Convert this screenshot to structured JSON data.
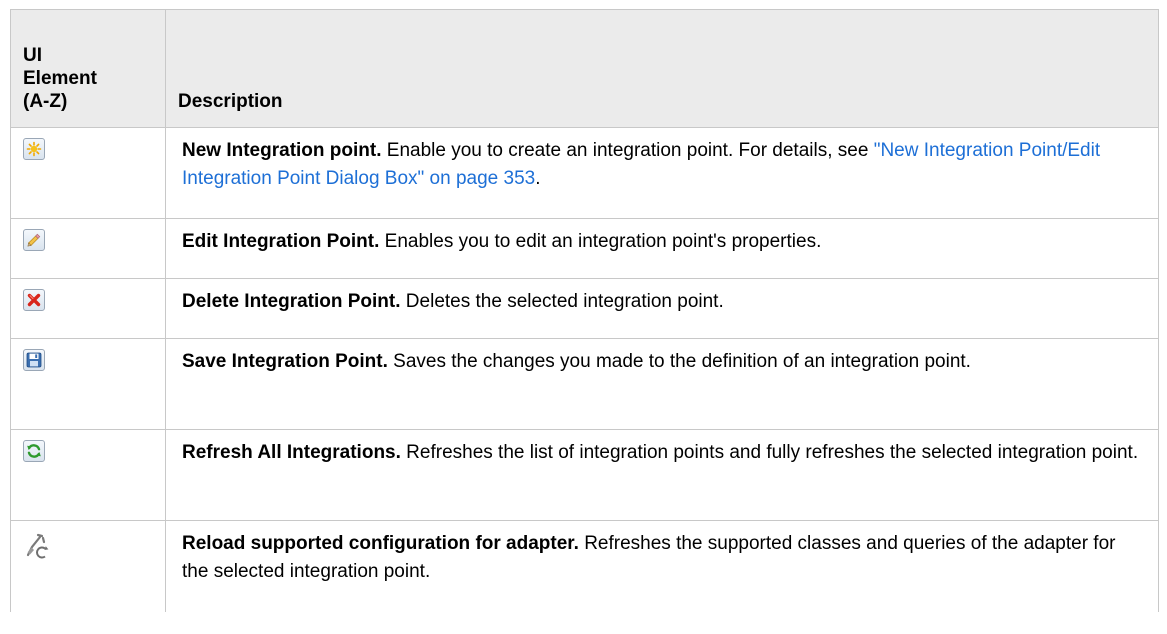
{
  "table": {
    "header": {
      "col1_lines": [
        "UI",
        "Element",
        "(A-Z)"
      ],
      "col2": "Description"
    },
    "rows": [
      {
        "icon": "new-star-icon",
        "name": "New Integration point.",
        "text": " Enable you to create an integration point. For details, see ",
        "link": "\"New Integration Point/Edit Integration Point Dialog Box\" on page 353",
        "after": "."
      },
      {
        "icon": "pencil-edit-icon",
        "name": "Edit Integration Point.",
        "text": " Enables you to edit an integration point's properties."
      },
      {
        "icon": "red-x-delete-icon",
        "name": "Delete Integration Point.",
        "text": " Deletes the selected integration point."
      },
      {
        "icon": "floppy-save-icon",
        "name": "Save Integration Point.",
        "text": " Saves the changes you made to the definition of an integration point."
      },
      {
        "icon": "green-refresh-icon",
        "name": "Refresh All Integrations.",
        "text": " Refreshes the list of integration points and fully refreshes the selected integration point."
      },
      {
        "icon": "reload-config-wrench-icon",
        "name": "Reload supported configuration for adapter.",
        "text": " Refreshes the supported classes and queries of the adapter for the selected integration point."
      }
    ]
  },
  "colors": {
    "link": "#1d6fd6",
    "header_bg": "#ebebeb",
    "border": "#c8c8c8"
  }
}
